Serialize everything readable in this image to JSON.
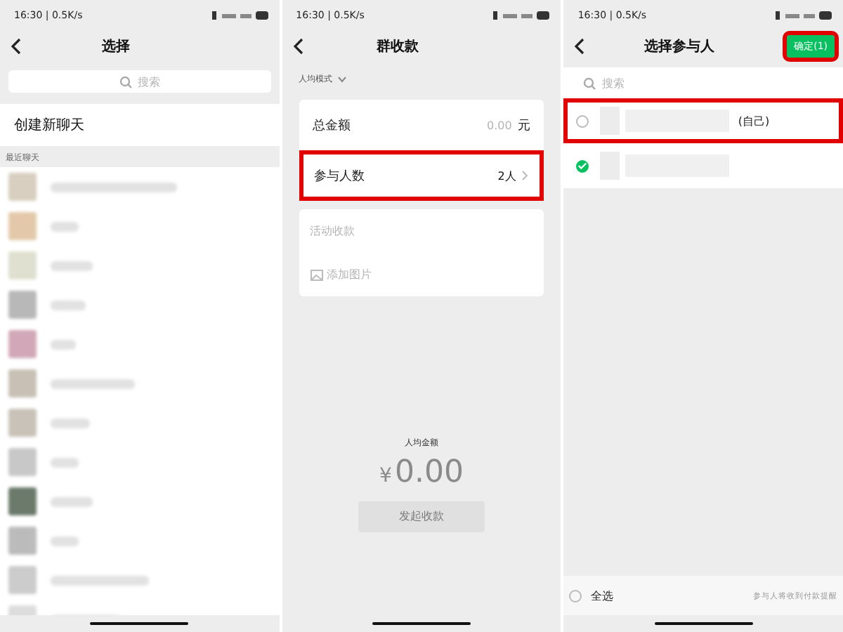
{
  "panels": [
    {
      "kind": "chat_picker",
      "status_bar": {
        "time": "16:30 | 0.5K/s"
      },
      "title": "选择",
      "search": {
        "placeholder": "搜索"
      },
      "new_chat": "创建新聊天",
      "section_label": "最近聊天"
    },
    {
      "kind": "group_collect",
      "status_bar": {
        "time": "16:30 | 0.5K/s"
      },
      "title": "群收款",
      "mode": "人均模式",
      "fields": [
        {
          "label": "总金额",
          "value": "0.00",
          "unit": "元",
          "highlighted": false
        },
        {
          "label": "参与人数",
          "value": "2人",
          "highlighted": true
        }
      ],
      "note": {
        "placeholder": "活动收款"
      },
      "add_image": "添加图片",
      "per_person_label": "人均金额",
      "currency": "¥",
      "per_person_amount": "0.00",
      "submit": {
        "label": "发起收款",
        "disabled": true
      }
    },
    {
      "kind": "participant_picker",
      "status_bar": {
        "time": "16:30 | 0.5K/s"
      },
      "title": "选择参与人",
      "confirm": {
        "label": "确定(1)",
        "highlighted": true
      },
      "search": {
        "placeholder": "搜索"
      },
      "participants": [
        {
          "suffix": "(自己)",
          "checked": false,
          "highlighted": true
        },
        {
          "checked": true,
          "highlighted": false
        }
      ],
      "select_all": {
        "label": "全选",
        "checked": false
      },
      "hint": "参与人将收到付款提醒"
    }
  ]
}
